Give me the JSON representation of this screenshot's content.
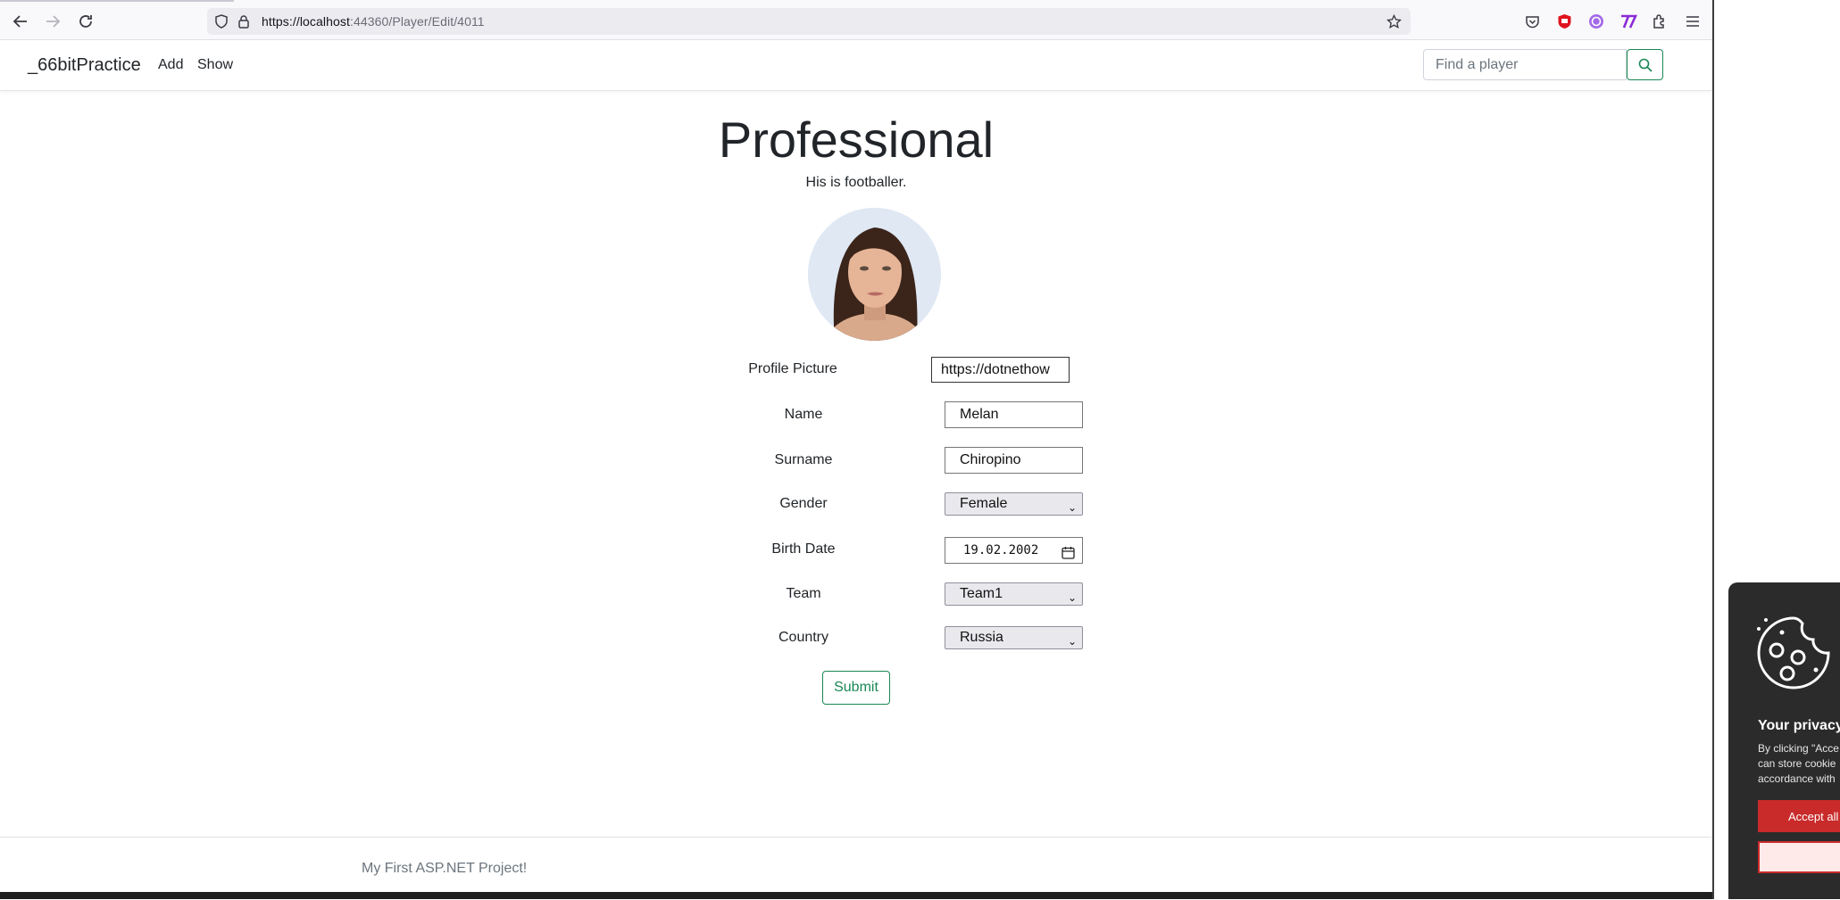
{
  "browser": {
    "url_host": "https://localhost",
    "url_rest": ":44360/Player/Edit/4011"
  },
  "navbar": {
    "brand": "_66bitPractice",
    "links": [
      {
        "label": "Add"
      },
      {
        "label": "Show"
      }
    ],
    "search_placeholder": "Find a player"
  },
  "main": {
    "title": "Professional",
    "subtitle": "His is footballer.",
    "fields": {
      "profile_picture": {
        "label": "Profile Picture",
        "value": "https://dotnethow"
      },
      "name": {
        "label": "Name",
        "value": "Melan"
      },
      "surname": {
        "label": "Surname",
        "value": "Chiropino"
      },
      "gender": {
        "label": "Gender",
        "value": "Female"
      },
      "birth_date": {
        "label": "Birth Date",
        "value": "19.02.2002"
      },
      "team": {
        "label": "Team",
        "value": "Team1"
      },
      "country": {
        "label": "Country",
        "value": "Russia"
      }
    },
    "submit_label": "Submit"
  },
  "footer": {
    "text": "My First ASP.NET Project!"
  },
  "cookie_banner": {
    "title": "Your privacy",
    "text": "By clicking \"Acce\ncan store cookie\naccordance with",
    "accept_label": "Accept all"
  },
  "colors": {
    "accent_green": "#198754",
    "cookie_bg": "#2b2b2b",
    "cookie_accept": "#c92a2a"
  }
}
